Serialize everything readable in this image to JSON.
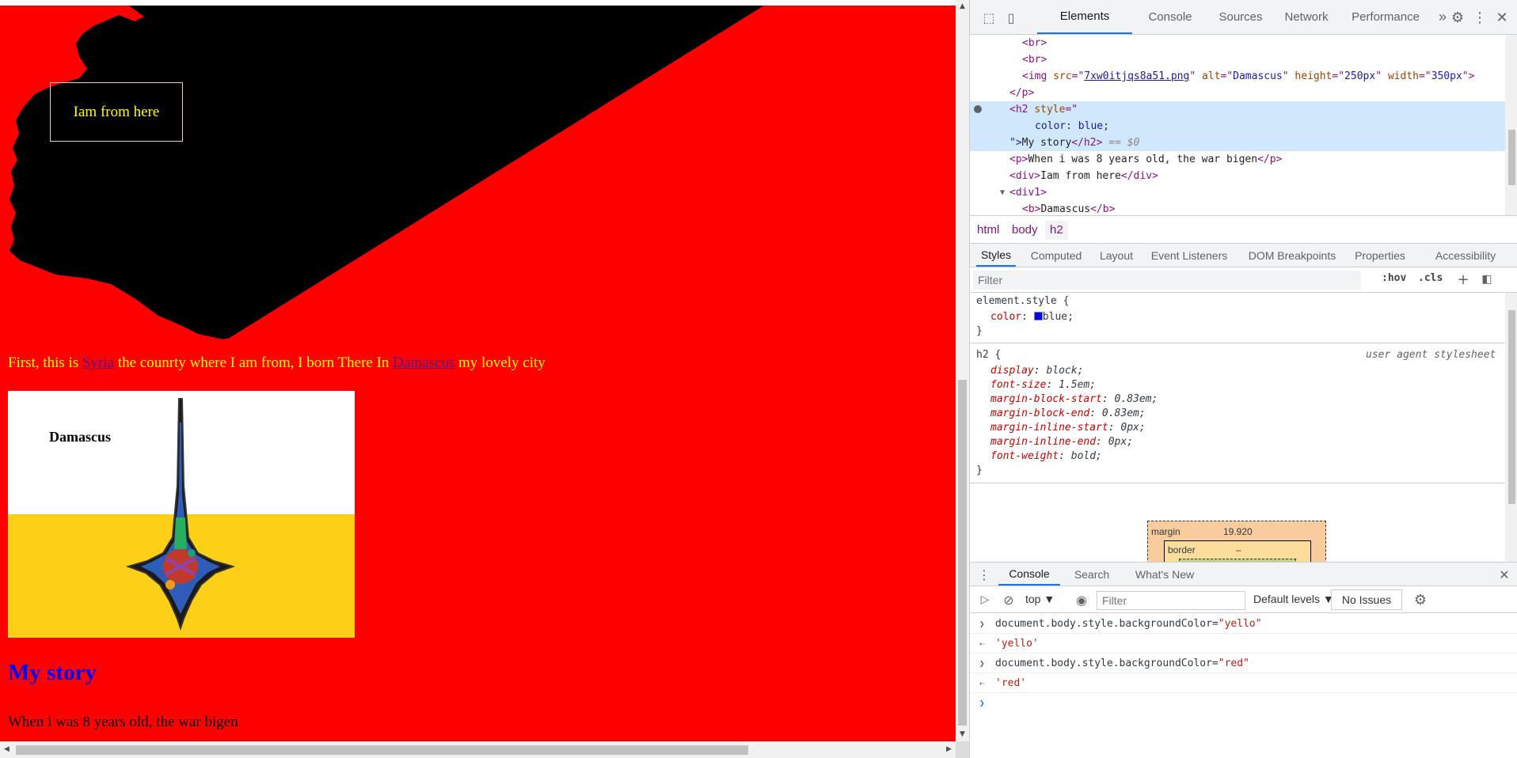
{
  "page": {
    "box_text": "Iam from here",
    "intro": {
      "before": "First, this is ",
      "link1": "Syria",
      "middle": " the counrty where I am from, I born There In ",
      "link2": "Damascus",
      "after": " my lovely city"
    },
    "flag_label": "Damascus",
    "heading": "My story",
    "paragraph": "When i was 8 years old, the war bigen"
  },
  "devtools": {
    "main_tabs": [
      "Elements",
      "Console",
      "Sources",
      "Network",
      "Performance"
    ],
    "more_tabs": "»",
    "dom": {
      "line1": "<br>",
      "line2": "<br>",
      "img_tag": "<img ",
      "img_src_attr": "src",
      "img_src_val": "7xw0itjqs8a51.png",
      "img_alt_attr": "alt",
      "img_alt_val": "Damascus",
      "img_h_attr": "height",
      "img_h_val": "250px",
      "img_w_attr": "width",
      "img_w_val": "350px",
      "p_close": "</p>",
      "h2_open": "<h2 ",
      "h2_style_attr": "style",
      "h2_style_q": "=\"",
      "h2_style_val": "color: blue;",
      "h2_close_q": "\">",
      "h2_text": "My story",
      "h2_close": "</h2>",
      "h2_eq": " == $0",
      "p_open": "<p>",
      "p_text": "When i was 8 years old, the war bigen",
      "p_close2": "</p>",
      "div_open": "<div>",
      "div_text": "Iam from here",
      "div_close": "</div>",
      "div1_open": "<div1>",
      "b_open": "<b>",
      "b_text": "Damascus",
      "b_close": "</b>"
    },
    "breadcrumb": [
      "html",
      "body",
      "h2"
    ],
    "sub_tabs": [
      "Styles",
      "Computed",
      "Layout",
      "Event Listeners",
      "DOM Breakpoints",
      "Properties",
      "Accessibility"
    ],
    "styles_filter_placeholder": "Filter",
    "hov": ":hov",
    "cls": ".cls",
    "element_style": {
      "selector": "element.style {",
      "prop": "color",
      "value": "blue;",
      "close": "}",
      "swatch_color": "#0000ff"
    },
    "h2_rule": {
      "selector": "h2 {",
      "source": "user agent stylesheet",
      "decls": [
        {
          "p": "display",
          "v": "block;"
        },
        {
          "p": "font-size",
          "v": "1.5em;"
        },
        {
          "p": "margin-block-start",
          "v": "0.83em;"
        },
        {
          "p": "margin-block-end",
          "v": "0.83em;"
        },
        {
          "p": "margin-inline-start",
          "v": "0px;"
        },
        {
          "p": "margin-inline-end",
          "v": "0px;"
        },
        {
          "p": "font-weight",
          "v": "bold;"
        }
      ],
      "close": "}"
    },
    "box_model": {
      "margin_label": "margin",
      "margin_value": "19.920",
      "border_label": "border",
      "border_value": "–"
    },
    "drawer_tabs": [
      "Console",
      "Search",
      "What's New"
    ],
    "console_toolbar": {
      "context": "top",
      "filter_placeholder": "Filter",
      "levels": "Default levels",
      "issues": "No Issues"
    },
    "console_lines": [
      {
        "kind": "input",
        "code": "document.body.style.backgroundColor=",
        "str": "\"yello\""
      },
      {
        "kind": "output",
        "str": "'yello'"
      },
      {
        "kind": "input",
        "code": "document.body.style.backgroundColor=",
        "str": "\"red\""
      },
      {
        "kind": "output",
        "str": "'red'"
      }
    ]
  }
}
